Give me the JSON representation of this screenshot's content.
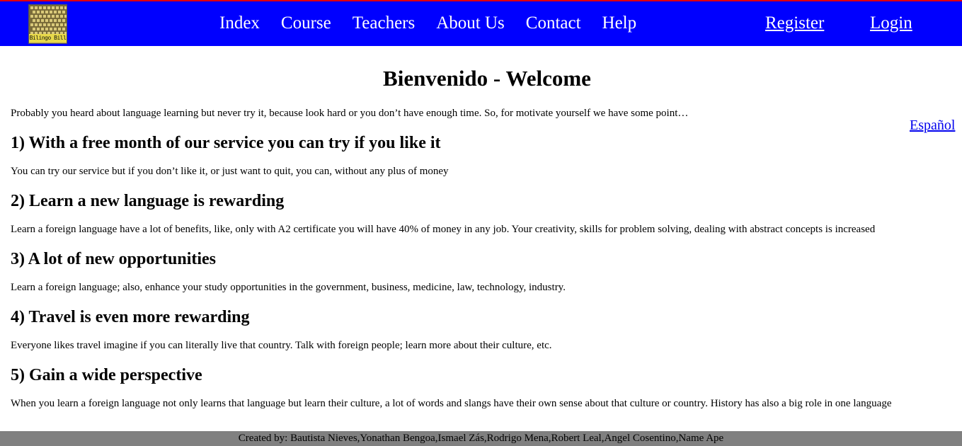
{
  "header": {
    "logo_text": "Bilingo Bill",
    "nav": [
      "Index",
      "Course",
      "Teachers",
      "About Us",
      "Contact",
      "Help"
    ],
    "register_label": "Register",
    "login_label": "Login",
    "bar_color": "#0000ff"
  },
  "main": {
    "title": "Bienvenido - Welcome",
    "intro": "Probably you heard about language learning but never try it, because look hard or you don’t have enough time. So, for motivate yourself we have some point…",
    "language_link": "Español",
    "points": [
      {
        "heading": "1) With a free month of our service you can try if you like it",
        "text": "You can try our service but if you don’t like it, or just want to quit, you can, without any plus of money"
      },
      {
        "heading": "2) Learn a new language is rewarding",
        "text": "Learn a foreign language have a lot of benefits, like, only with A2 certificate you will have 40% of money in any job. Your creativity, skills for problem solving, dealing with abstract concepts is increased"
      },
      {
        "heading": "3) A lot of new opportunities",
        "text": "Learn a foreign language; also, enhance your study opportunities in the government, business, medicine, law, technology, industry."
      },
      {
        "heading": "4) Travel is even more rewarding",
        "text": "Everyone likes travel imagine if you can literally live that country. Talk with foreign people; learn more about their culture, etc."
      },
      {
        "heading": "5) Gain a wide perspective",
        "text": "When you learn a foreign language not only learns that language but learn their culture, a lot of words and slangs have their own sense about that culture or country. History has also a big role in one language"
      }
    ]
  },
  "footer": {
    "credits": "Created by: Bautista Nieves,Yonathan Bengoa,Ismael Zás,Rodrigo Mena,Robert Leal,Angel Cosentino,Name Ape",
    "bar_color": "#808080"
  }
}
